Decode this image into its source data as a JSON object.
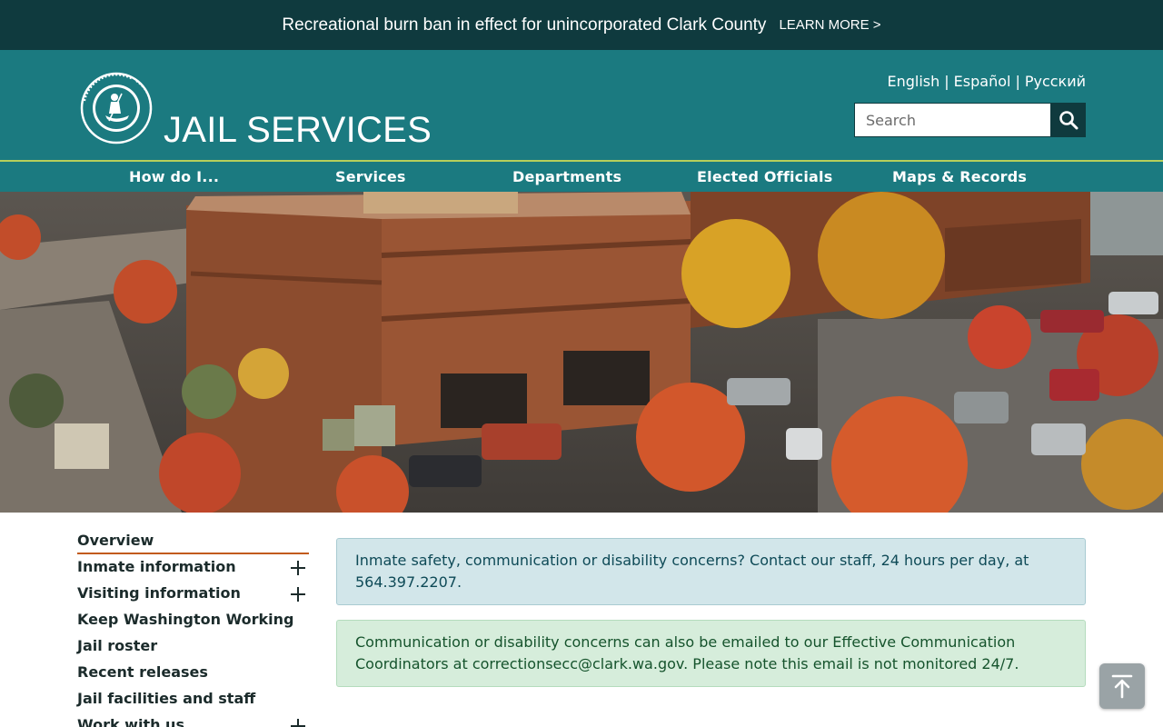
{
  "alert": {
    "text": "Recreational burn ban in effect for unincorporated Clark County",
    "link_label": "LEARN MORE >"
  },
  "header": {
    "seal_alt": "CLARK COUNTY, WASHINGTON",
    "title": "JAIL SERVICES",
    "languages": [
      "English",
      "Español",
      "Русский"
    ],
    "language_separator": "|",
    "search": {
      "placeholder": "Search",
      "value": ""
    },
    "search_icon": "magnifier-icon"
  },
  "nav": {
    "items": [
      "How do I...",
      "Services",
      "Departments",
      "Elected Officials",
      "Maps & Records"
    ]
  },
  "hero": {
    "description": "Clark County jail building with autumn trees and parking lot"
  },
  "sidebar": {
    "items": [
      {
        "label": "Overview",
        "active": true,
        "expandable": false
      },
      {
        "label": "Inmate information",
        "active": false,
        "expandable": true
      },
      {
        "label": "Visiting information",
        "active": false,
        "expandable": true
      },
      {
        "label": "Keep Washington Working",
        "active": false,
        "expandable": false
      },
      {
        "label": "Jail roster",
        "active": false,
        "expandable": false
      },
      {
        "label": "Recent releases",
        "active": false,
        "expandable": false
      },
      {
        "label": "Jail facilities and staff",
        "active": false,
        "expandable": false
      },
      {
        "label": "Work with us",
        "active": false,
        "expandable": true
      }
    ]
  },
  "notices": {
    "info": "Inmate safety, communication or disability concerns? Contact our staff, 24 hours per day, at 564.397.2207.",
    "success": "Communication or disability concerns can also be emailed to our Effective Communication Coordinators at correctionsecc@clark.wa.gov. Please note this email is not monitored 24/7."
  },
  "colors": {
    "alert_bg": "#0f3a3e",
    "header_bg": "#1b7a80",
    "nav_border": "#b6cf5a",
    "active_underline": "#c25a1a",
    "info_bg": "#d2e6ea",
    "success_bg": "#d6eddb"
  },
  "back_to_top_icon": "arrow-up-to-line-icon"
}
